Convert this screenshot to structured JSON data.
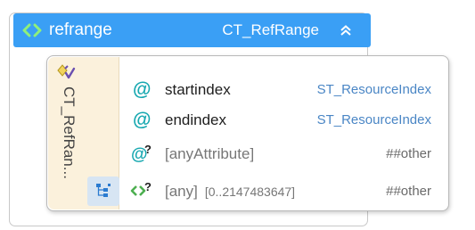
{
  "element": {
    "name": "refrange",
    "type": "CT_RefRange",
    "colors": {
      "header_bg": "#3a9ff5",
      "icon_green": "#8ff07a",
      "attr_teal": "#17a8b0",
      "link_blue": "#4a86c5"
    }
  },
  "complex_type": {
    "label": "CT_RefRan..."
  },
  "rows": [
    {
      "icon": "attribute-icon",
      "name": "startindex",
      "type": "ST_ResourceIndex"
    },
    {
      "icon": "attribute-icon",
      "name": "endindex",
      "type": "ST_ResourceIndex"
    },
    {
      "icon": "any-attribute-icon",
      "name": "[anyAttribute]",
      "type": "##other"
    },
    {
      "icon": "any-element-icon",
      "name": "[any]",
      "occurrence": "[0..2147483647]",
      "type": "##other"
    }
  ]
}
